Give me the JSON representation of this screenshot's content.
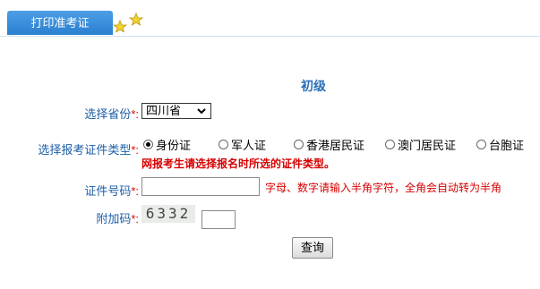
{
  "tab": {
    "label": "打印准考证"
  },
  "level": "初级",
  "province": {
    "label": "选择省份",
    "required": "*:",
    "selected": "四川省"
  },
  "cert_type": {
    "label": "选择报考证件类型",
    "required": "*:",
    "options": [
      "身份证",
      "军人证",
      "香港居民证",
      "澳门居民证",
      "台胞证"
    ],
    "selected_index": 0,
    "warning": "网报考生请选择报名时所选的证件类型。"
  },
  "cert_number": {
    "label": "证件号码",
    "required": "*:",
    "value": "",
    "hint": "字母、数字请输入半角字符，全角会自动转为半角"
  },
  "captcha": {
    "label": "附加码",
    "required": "*:",
    "code": "6332",
    "value": ""
  },
  "submit": {
    "label": "查询"
  },
  "colors": {
    "tab_blue": "#2a7fd0",
    "label_blue": "#1d5ea8",
    "warning_red": "#d60000"
  }
}
